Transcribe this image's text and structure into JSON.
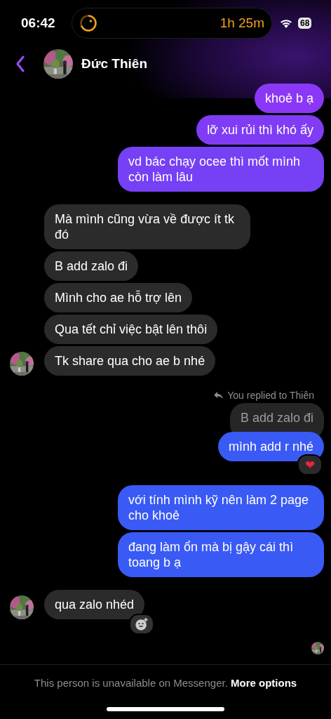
{
  "status_bar": {
    "time": "06:42",
    "timer": "1h 25m",
    "battery": "68"
  },
  "header": {
    "contact_name": "Đức Thiên"
  },
  "messages": [
    {
      "kind": "sent",
      "text": "khoẻ b ạ"
    },
    {
      "kind": "sent",
      "text": "lỡ xui rủi thì khó ấy"
    },
    {
      "kind": "sent",
      "text": "vd bác chạy ocee thì mốt mình còn làm lâu"
    },
    {
      "kind": "received",
      "text": "Mà mình cũng vừa về được ít tk đó",
      "avatar": false
    },
    {
      "kind": "received",
      "text": "B add zalo đi",
      "avatar": false
    },
    {
      "kind": "received",
      "text": "Mình cho ae hỗ trợ lên",
      "avatar": false
    },
    {
      "kind": "received",
      "text": "Qua tết chỉ việc bật lên thôi",
      "avatar": false
    },
    {
      "kind": "received",
      "text": "Tk share qua cho ae b nhé",
      "avatar": true
    },
    {
      "kind": "reply_label",
      "text": "You replied to Thiên"
    },
    {
      "kind": "quoted",
      "text": "B add zalo đi"
    },
    {
      "kind": "sent",
      "text": "mình add r nhé",
      "reaction": "❤"
    },
    {
      "kind": "sent",
      "text": "với tính mình kỹ nên làm 2 page cho khoẻ"
    },
    {
      "kind": "sent",
      "text": "đang làm ổn mà bị gậy cái thì toang b ạ"
    },
    {
      "kind": "received",
      "text": "qua zalo nhéd",
      "avatar": true,
      "add_reaction": true
    }
  ],
  "seen": true,
  "footer": {
    "notice": "This person is unavailable on Messenger.",
    "link": "More options"
  }
}
